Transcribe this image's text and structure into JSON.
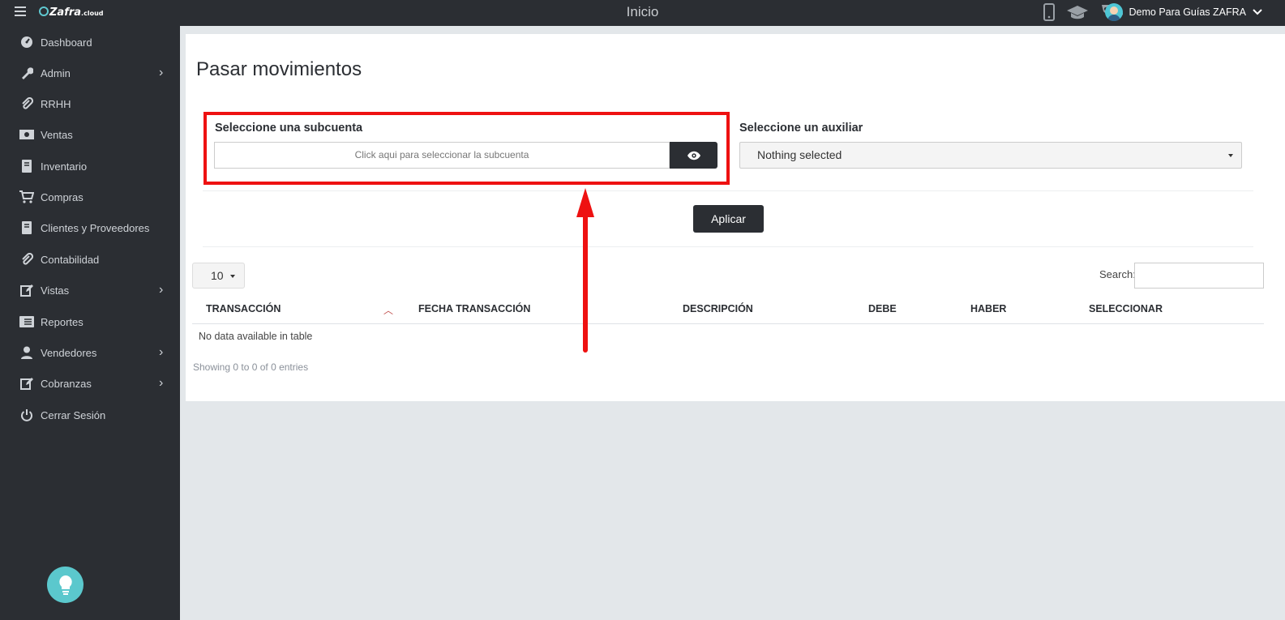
{
  "topbar": {
    "logo_text": "Zafra",
    "logo_suffix": ".cloud",
    "page_title": "Inicio",
    "user_name": "Demo Para Guías ZAFRA"
  },
  "sidebar": {
    "items": [
      {
        "label": "Dashboard",
        "icon": "dashboard-icon",
        "has_children": false
      },
      {
        "label": "Admin",
        "icon": "wrench-icon",
        "has_children": true
      },
      {
        "label": "RRHH",
        "icon": "paperclip-icon",
        "has_children": false
      },
      {
        "label": "Ventas",
        "icon": "money-icon",
        "has_children": false
      },
      {
        "label": "Inventario",
        "icon": "book-icon",
        "has_children": false
      },
      {
        "label": "Compras",
        "icon": "cart-icon",
        "has_children": false
      },
      {
        "label": "Clientes y Proveedores",
        "icon": "book-icon",
        "has_children": false
      },
      {
        "label": "Contabilidad",
        "icon": "paperclip-icon",
        "has_children": false
      },
      {
        "label": "Vistas",
        "icon": "edit-icon",
        "has_children": true
      },
      {
        "label": "Reportes",
        "icon": "list-icon",
        "has_children": false
      },
      {
        "label": "Vendedores",
        "icon": "user-icon",
        "has_children": true
      },
      {
        "label": "Cobranzas",
        "icon": "edit-icon",
        "has_children": true
      },
      {
        "label": "Cerrar Sesión",
        "icon": "power-icon",
        "has_children": false
      }
    ]
  },
  "main": {
    "title": "Pasar movimientos",
    "subcuenta_label": "Seleccione una subcuenta",
    "subcuenta_placeholder": "Click aqui para seleccionar la subcuenta",
    "auxiliar_label": "Seleccione un auxiliar",
    "auxiliar_value": "Nothing selected",
    "apply_label": "Aplicar",
    "page_length": "10",
    "search_label": "Search:",
    "columns": [
      "TRANSACCIÓN",
      "FECHA TRANSACCIÓN",
      "DESCRIPCIÓN",
      "DEBE",
      "HABER",
      "SELECCIONAR"
    ],
    "empty_message": "No data available in table",
    "info": "Showing 0 to 0 of 0 entries"
  },
  "colors": {
    "dark": "#2b2e33",
    "annotation": "#ee1111",
    "accent": "#5bc8cd"
  }
}
